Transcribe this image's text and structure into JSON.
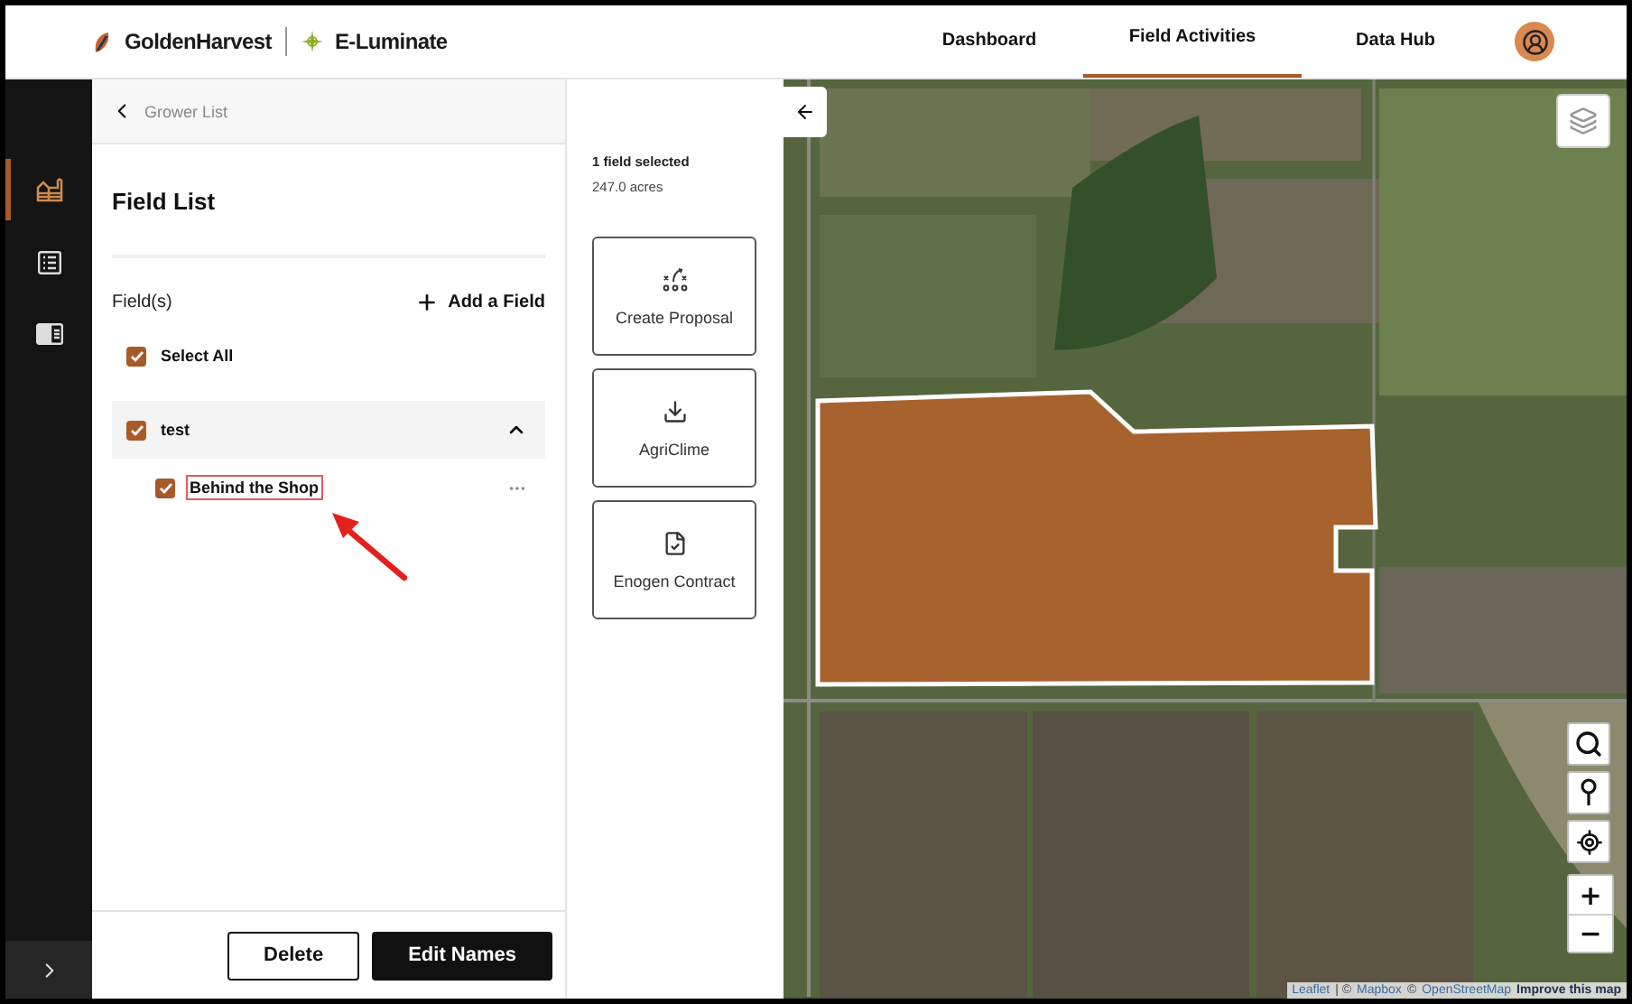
{
  "header": {
    "brand": "GoldenHarvest",
    "product": "E-Luminate",
    "nav": [
      {
        "label": "Dashboard",
        "selected": false
      },
      {
        "label": "Field Activities",
        "selected": true
      },
      {
        "label": "Data Hub",
        "selected": false
      }
    ]
  },
  "sidebar": {
    "items": [
      {
        "kind": "farm",
        "selected": true
      },
      {
        "kind": "list",
        "selected": false
      },
      {
        "kind": "panel",
        "selected": false
      }
    ]
  },
  "field_panel": {
    "breadcrumb": "Grower List",
    "title": "Field List",
    "fields_label": "Field(s)",
    "add_button": "Add a Field",
    "select_all": {
      "label": "Select All",
      "checked": true
    },
    "groups": [
      {
        "name": "test",
        "checked": true,
        "expanded": true,
        "fields": [
          {
            "name": "Behind the Shop",
            "checked": true,
            "highlighted": true
          }
        ]
      }
    ],
    "buttons": [
      {
        "label": "Delete",
        "kind": "secondary"
      },
      {
        "label": "Edit Names",
        "kind": "primary"
      }
    ]
  },
  "actions_panel": {
    "selection": "1 field selected",
    "area": "247.0 acres",
    "actions": [
      {
        "label": "Create Proposal",
        "kind": "proposal"
      },
      {
        "label": "AgriClime",
        "kind": "download"
      },
      {
        "label": "Enogen Contract",
        "kind": "contract"
      }
    ]
  },
  "map": {
    "zoom_in": "+",
    "zoom_out": "−",
    "attribution": [
      {
        "text": "Leaflet",
        "kind": "link"
      },
      {
        "text": "| ©",
        "kind": "text"
      },
      {
        "text": "Mapbox",
        "kind": "link"
      },
      {
        "text": "©",
        "kind": "text"
      },
      {
        "text": "OpenStreetMap",
        "kind": "link"
      },
      {
        "text": "Improve this map",
        "kind": "strong-link"
      }
    ]
  }
}
